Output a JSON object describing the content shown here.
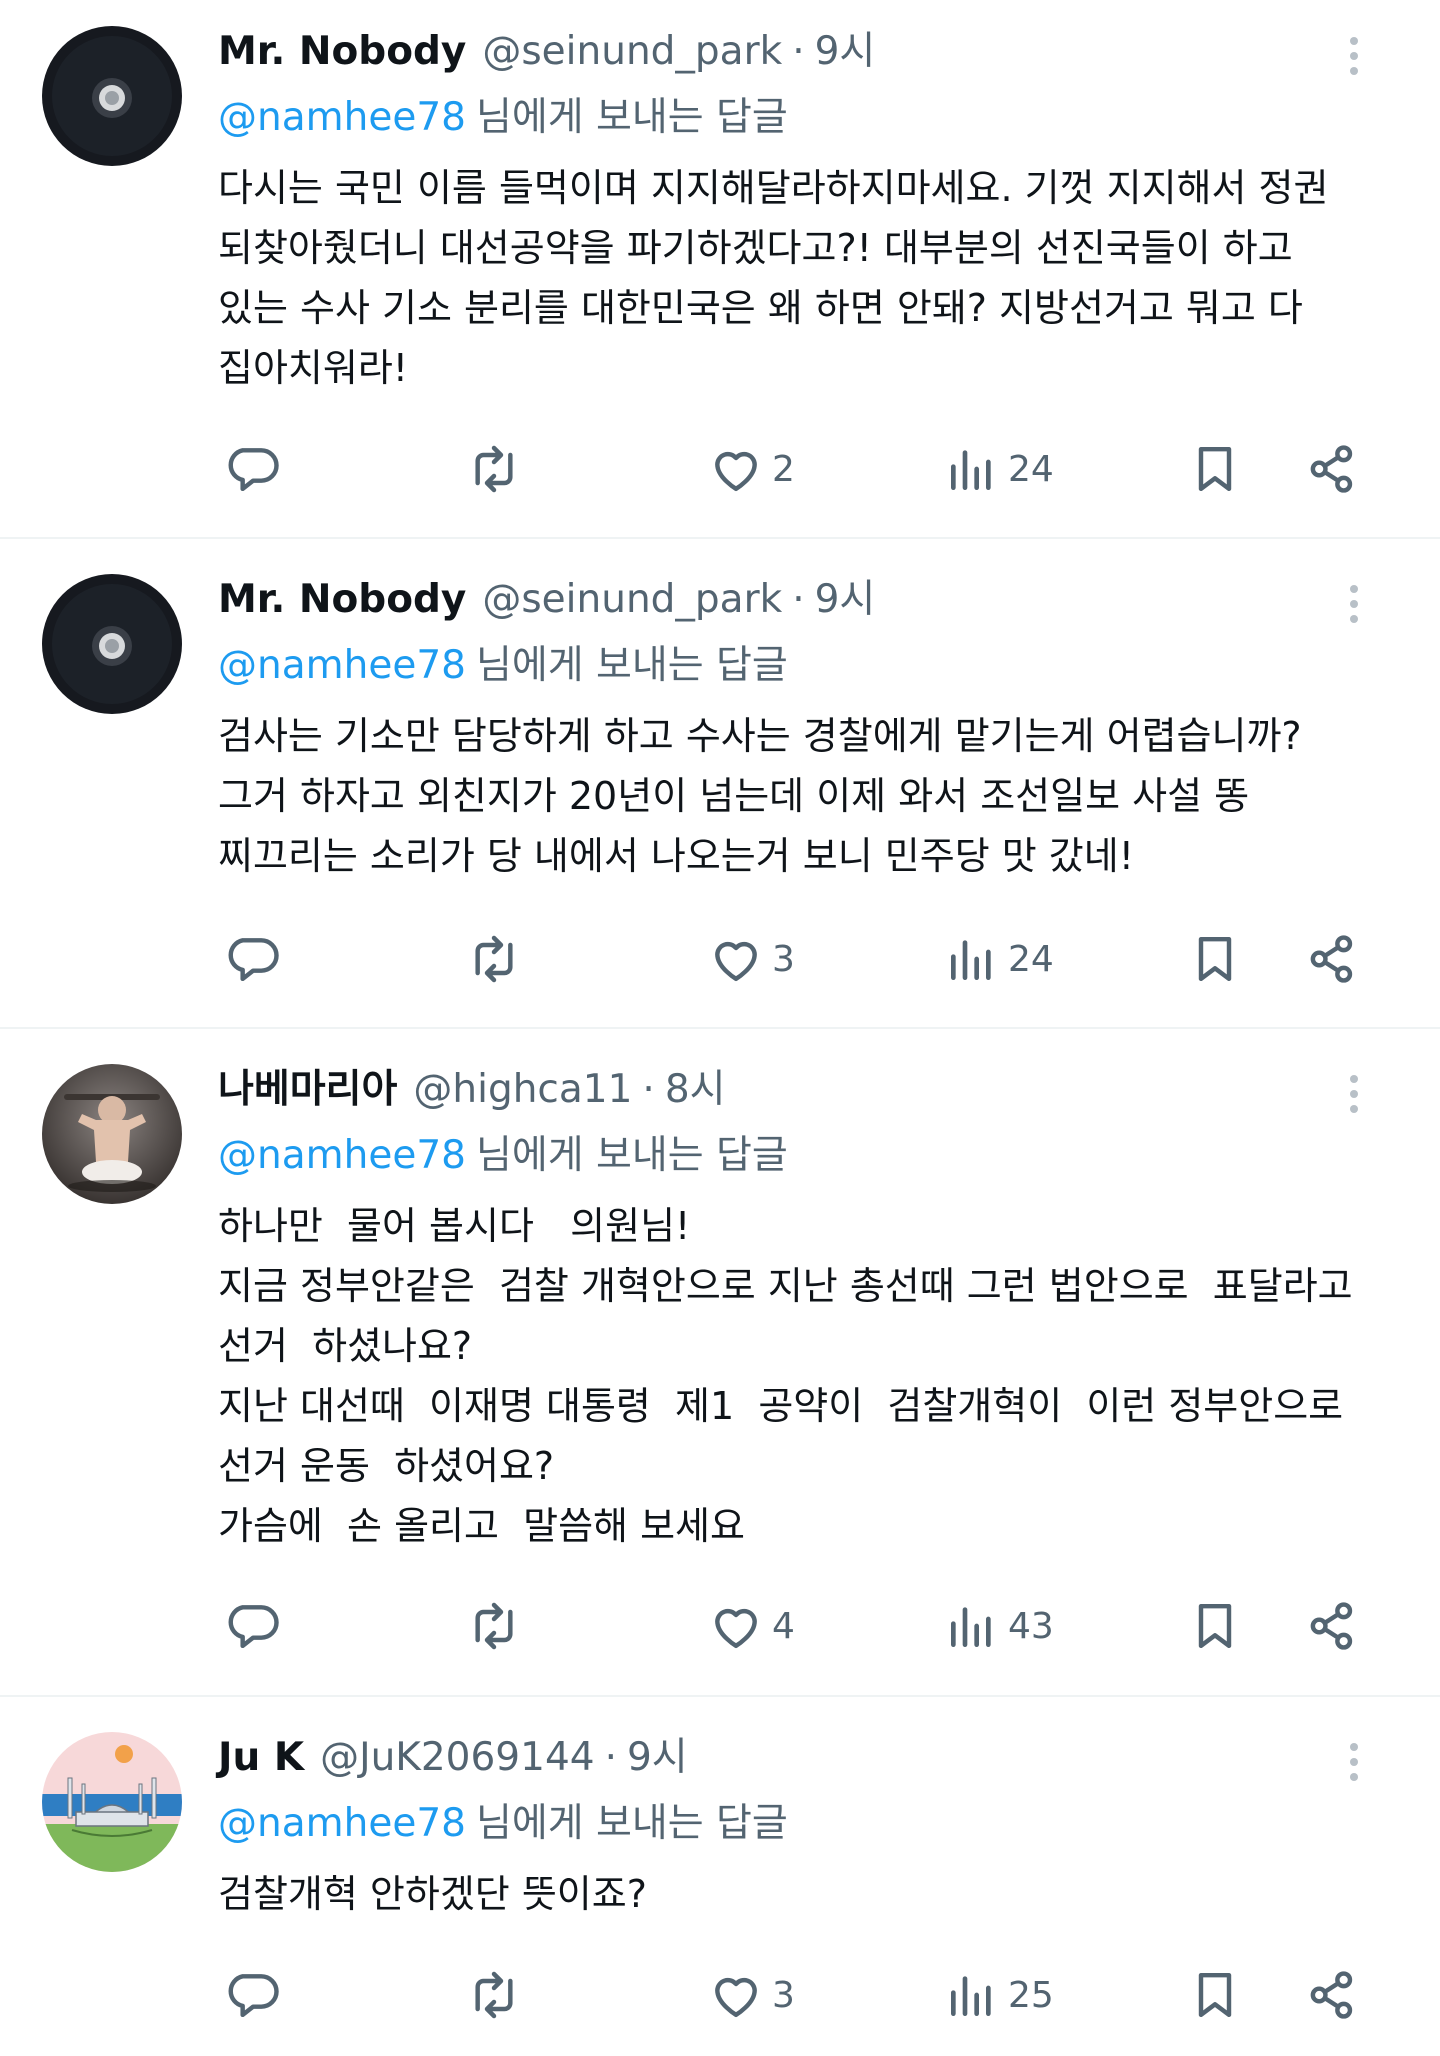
{
  "replying_to_suffix": "님에게 보내는 답글",
  "colors": {
    "link": "#1d9bf0",
    "secondary": "#536471",
    "text": "#0f1419",
    "divider": "#eff3f4"
  },
  "tweets": [
    {
      "name": "Mr. Nobody",
      "handle": "@seinund_park",
      "time": "9시",
      "reply_to": "@namhee78",
      "lines": [
        "다시는 국민 이름 들먹이며 지지해달라하지마세요. 기껏 지지해서 정권",
        "되찾아줬더니 대선공약을 파기하겠다고?! 대부분의 선진국들이 하고",
        "있는 수사 기소 분리를 대한민국은 왜 하면 안돼? 지방선거고 뭐고 다",
        "집아치워라!"
      ],
      "likes": "2",
      "views": "24",
      "avatar_icon": "dark-orb-avatar"
    },
    {
      "name": "Mr. Nobody",
      "handle": "@seinund_park",
      "time": "9시",
      "reply_to": "@namhee78",
      "lines": [
        "검사는 기소만 담당하게 하고 수사는 경찰에게 맡기는게 어렵습니까?",
        "그거 하자고 외친지가 20년이 넘는데 이제 와서 조선일보 사설 똥",
        "찌끄리는 소리가 당 내에서 나오는거 보니 민주당 맛 갔네!"
      ],
      "likes": "3",
      "views": "24",
      "avatar_icon": "dark-orb-avatar"
    },
    {
      "name": "나베마리아",
      "handle": "@highca11",
      "time": "8시",
      "reply_to": "@namhee78",
      "lines": [
        "하나만  물어 봅시다   의원님!",
        "지금 정부안같은  검찰 개혁안으로 지난 총선때 그런 법안으로  표달라고",
        "선거  하셨나요?",
        "지난 대선때  이재명 대통령  제1  공약이  검찰개혁이  이런 정부안으로",
        "선거 운동  하셨어요?",
        "가슴에  손 올리고  말씀해 보세요"
      ],
      "likes": "4",
      "views": "43",
      "avatar_icon": "baby-photo-avatar"
    },
    {
      "name": "Ju K",
      "handle": "@JuK2069144",
      "time": "9시",
      "reply_to": "@namhee78",
      "lines": [
        "검찰개혁 안하겠단 뜻이죠?"
      ],
      "likes": "3",
      "views": "25",
      "avatar_icon": "mosque-illustration-avatar"
    }
  ]
}
